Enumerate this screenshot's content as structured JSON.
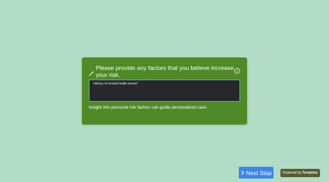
{
  "question": {
    "icon": "sparkle-pencil-icon",
    "title": "Please provide any factors that you believe increase your risk.",
    "info_icon": "info-circle-icon",
    "answer_value": "\"History of mental health issues.\"",
    "hint": "Insight into personal risk factors can guide personalized care."
  },
  "footer": {
    "next_label": "Next Step",
    "next_icon": "chevron-right-icon",
    "powered_prefix": "Powered by",
    "powered_brand": "Teramine"
  },
  "colors": {
    "background": "#b2dcc5",
    "card": "#4e8a25",
    "input_bg": "#25272b",
    "input_border": "#6fa0d6",
    "next_button": "#3a86f2",
    "powered_badge": "#585d33"
  }
}
